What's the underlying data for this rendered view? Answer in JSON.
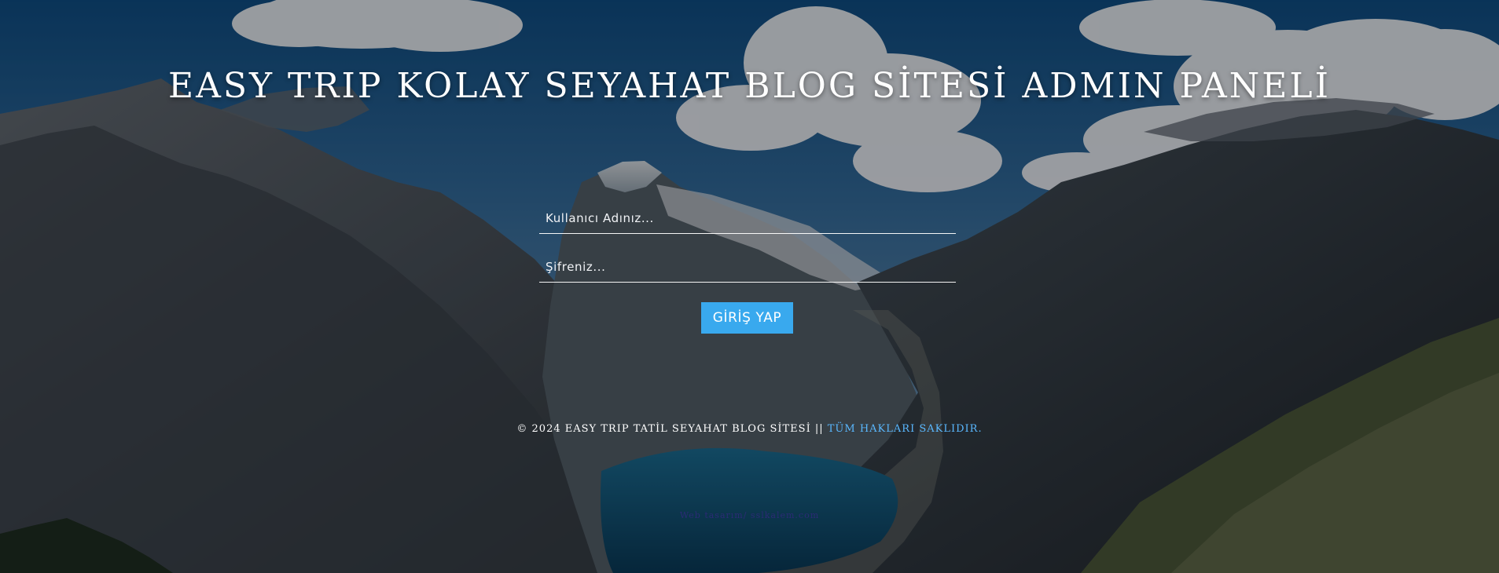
{
  "page": {
    "title": "EASY TRIP KOLAY SEYAHAT BLOG SİTESİ ADMIN PANELİ"
  },
  "login": {
    "username_placeholder": "Kullanıcı Adınız...",
    "password_placeholder": "Şifreniz...",
    "button_label": "GİRİŞ YAP"
  },
  "footer": {
    "copyright_text": "© 2024 EASY TRIP TATİL SEYAHAT BLOG SİTESİ || ",
    "rights_text": "TÜM HAKLARI SAKLIDIR."
  },
  "misc": {
    "faint_text": "Web tasarım/ sslkalem.com"
  },
  "colors": {
    "accent": "#39a9ee",
    "footer_link": "#5ab8ff",
    "text": "#ffffff"
  }
}
